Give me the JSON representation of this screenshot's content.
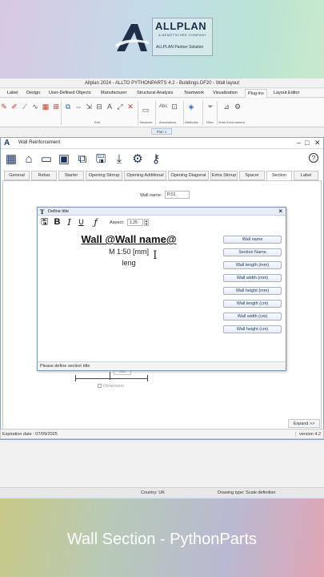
{
  "brand": {
    "logo_word": "ALLPLAN",
    "logo_sub": "A NEMETSCHEK COMPANY",
    "partner": "ALLPLAN Partner Solution"
  },
  "app": {
    "title": "Allplan 2024 - ALLTO PYTHONPARTS 4.2 - Buildings.DF20 - Wall layout",
    "menu": [
      "Label",
      "Design",
      "User-Defined Objects",
      "Manufacturer",
      "Structural Analysis",
      "Teamwork",
      "Visualization",
      "Plug-ins",
      "Layout Editor"
    ],
    "menu_active": "Plug-ins",
    "ribbon_groups": [
      "Edit",
      "Measure",
      "Annotations",
      "Attributes",
      "Filter",
      "Work Environment"
    ],
    "plan_tab": "Plan 1"
  },
  "dialog": {
    "title": "Wall Reinforcement",
    "tabs": [
      "General",
      "Rebar",
      "Starter",
      "Opening Stirrup",
      "Opening Additional",
      "Opening Diagonal",
      "Extra Stirrup",
      "Spacer",
      "Section",
      "Label"
    ],
    "active_tab": "Section",
    "wall_name_label": "Wall name:",
    "wall_name_value": "P.01",
    "dimension_value": "500",
    "dimension_check": "Dimension",
    "expand": "Expand >>",
    "expiration": "Expiration date : 07/09/2025",
    "version": "version 4.2"
  },
  "define_title": {
    "title": "Define title",
    "aspect_label": "Aspect:",
    "aspect_value": "1.25",
    "line1": "Wall @Wall name@",
    "line2": "M 1:50 [mm]",
    "line3": "leng",
    "buttons": [
      "Wall name",
      "Section Name",
      "Wall length (mm)",
      "Wall width (mm)",
      "Wall height (mm)",
      "Wall length (cm)",
      "Wall width (cm)",
      "Wall height (cm)"
    ],
    "status": "Please define section title"
  },
  "statusbar": {
    "country": "Country:  UK",
    "drawing_type": "Drawing type:  Scale definition"
  },
  "caption": "Wall Section - PythonParts"
}
